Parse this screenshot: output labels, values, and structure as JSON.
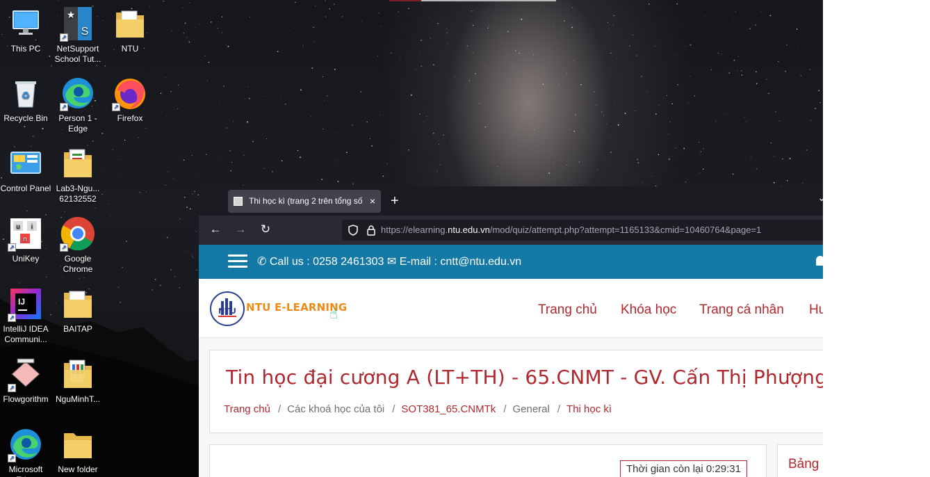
{
  "desktop": {
    "icons": [
      {
        "label": "This PC",
        "icon": "computer-icon"
      },
      {
        "label": "NetSupport School Tut...",
        "icon": "netsupport-icon"
      },
      {
        "label": "NTU",
        "icon": "folder-icon"
      },
      {
        "label": "Recycle Bin",
        "icon": "recycle-bin-icon"
      },
      {
        "label": "Person 1 - Edge",
        "icon": "edge-icon"
      },
      {
        "label": "Firefox",
        "icon": "firefox-icon"
      },
      {
        "label": "Control Panel",
        "icon": "control-panel-icon"
      },
      {
        "label": "Lab3-Ngu... 62132552",
        "icon": "folder-doc-icon"
      },
      {
        "label": "UniKey",
        "icon": "unikey-icon"
      },
      {
        "label": "Google Chrome",
        "icon": "chrome-icon"
      },
      {
        "label": "IntelliJ IDEA Communi...",
        "icon": "intellij-icon"
      },
      {
        "label": "BAITAP",
        "icon": "folder-icon"
      },
      {
        "label": "Flowgorithm",
        "icon": "flowgorithm-icon"
      },
      {
        "label": "NguMinhT...",
        "icon": "folder-doc-icon"
      },
      {
        "label": "Microsoft Edge",
        "icon": "edge-icon"
      },
      {
        "label": "New folder",
        "icon": "folder-icon"
      }
    ]
  },
  "browser": {
    "tab_title": "Thi học kì (trang 2 trên tổng số",
    "tab_close": "×",
    "new_tab": "+",
    "url_prefix": "https://elearning.",
    "url_host": "ntu.edu.vn",
    "url_path": "/mod/quiz/attempt.php?attempt=1165133&cmid=10460764&page=1"
  },
  "site": {
    "call_label": "Call us : 0258 2461303",
    "email_label": "E-mail : cntt@ntu.edu.vn",
    "logo_text": "NTU E-LEARNING",
    "nav": [
      "Trang chủ",
      "Khóa học",
      "Trang cá nhân",
      "Hư"
    ],
    "course_title": "Tin học đại cương A (LT+TH) - 65.CNMT - GV. Cấn Thị Phượng",
    "breadcrumb": [
      "Trang chủ",
      "Các khoá học của tôi",
      "SOT381_65.CNMTk",
      "General",
      "Thi học kì"
    ],
    "breadcrumb_sep": "/",
    "timer_label": "Thời gian còn lại 0:29:31",
    "side_title": "Bảng"
  },
  "colors": {
    "accent": "#b0282d",
    "infobar": "#1479a5",
    "tabbar": "#1c1b22",
    "navbar": "#2b2a33"
  }
}
